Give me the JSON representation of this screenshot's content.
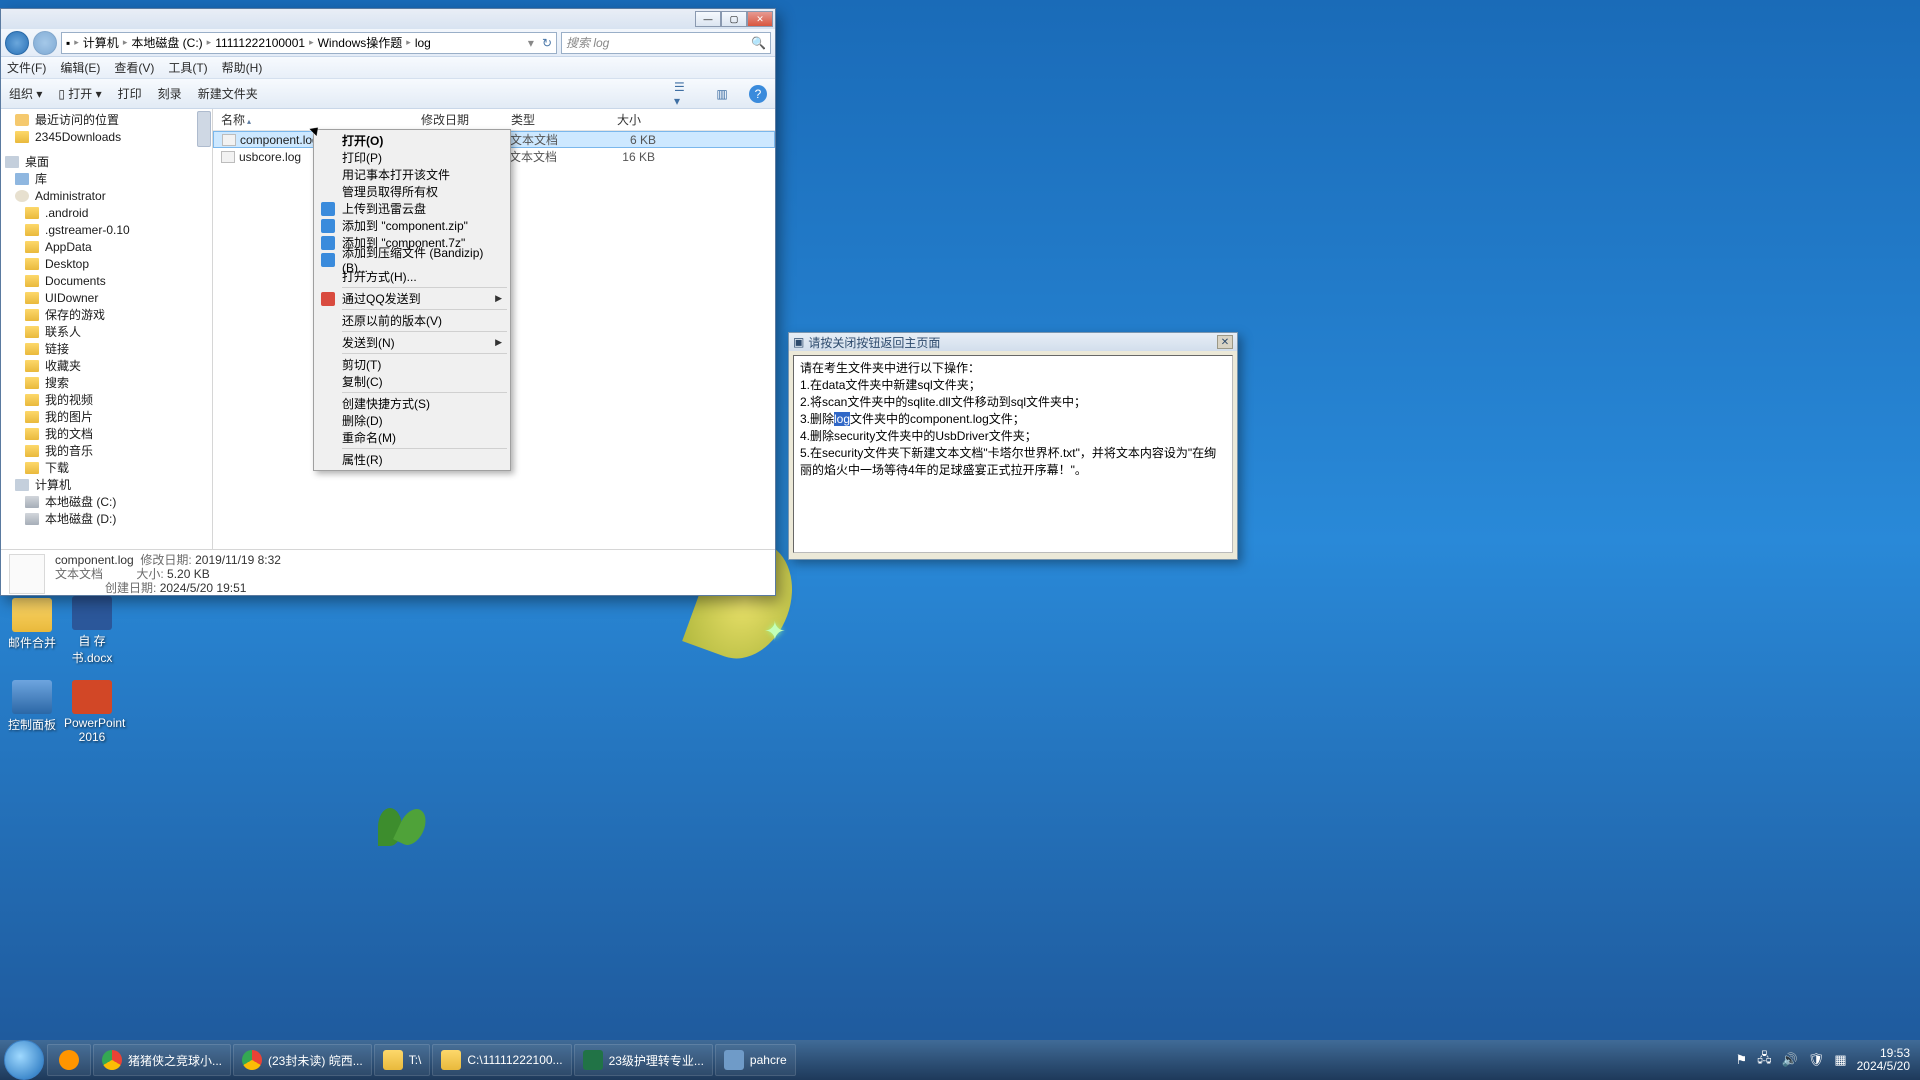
{
  "breadcrumb": [
    "计算机",
    "本地磁盘 (C:)",
    "11111222100001",
    "Windows操作题",
    "log"
  ],
  "search_placeholder": "搜索 log",
  "menus": [
    "文件(F)",
    "编辑(E)",
    "查看(V)",
    "工具(T)",
    "帮助(H)"
  ],
  "toolbar": {
    "organize": "组织 ▾",
    "open": "打开 ▾",
    "print": "打印",
    "burn": "刻录",
    "newfolder": "新建文件夹"
  },
  "columns": {
    "name": "名称",
    "date": "修改日期",
    "type": "类型",
    "size": "大小"
  },
  "files": [
    {
      "name": "component.log",
      "date": "2019/11/19 8:32",
      "type": "文本文档",
      "size": "6 KB",
      "selected": true
    },
    {
      "name": "usbcore.log",
      "date": "",
      "type": "文本文档",
      "size": "16 KB",
      "selected": false
    }
  ],
  "sidebar": {
    "recent": "最近访问的位置",
    "dl": "2345Downloads",
    "desktop": "桌面",
    "libs": "库",
    "admin": "Administrator",
    "items": [
      ".android",
      ".gstreamer-0.10",
      "AppData",
      "Desktop",
      "Documents",
      "UIDowner",
      "保存的游戏",
      "联系人",
      "链接",
      "收藏夹",
      "搜索",
      "我的视频",
      "我的图片",
      "我的文档",
      "我的音乐",
      "下载"
    ],
    "computer": "计算机",
    "driveC": "本地磁盘 (C:)",
    "driveD": "本地磁盘 (D:)"
  },
  "status": {
    "name": "component.log",
    "type": "文本文档",
    "l_date": "修改日期:",
    "date": "2019/11/19 8:32",
    "l_size": "大小:",
    "size": "5.20 KB",
    "l_created": "创建日期:",
    "created": "2024/5/20 19:51"
  },
  "context": [
    {
      "t": "打开(O)",
      "bold": true
    },
    {
      "t": "打印(P)"
    },
    {
      "t": "用记事本打开该文件"
    },
    {
      "t": "管理员取得所有权"
    },
    {
      "t": "上传到迅雷云盘",
      "ico": "cloud"
    },
    {
      "t": "添加到 \"component.zip\"",
      "ico": "zip"
    },
    {
      "t": "添加到 \"component.7z\"",
      "ico": "zip"
    },
    {
      "t": "添加到压缩文件 (Bandizip)(B)...",
      "ico": "zip"
    },
    {
      "t": "打开方式(H)..."
    },
    {
      "sep": true
    },
    {
      "t": "通过QQ发送到",
      "ico": "qq",
      "sub": true
    },
    {
      "sep": true
    },
    {
      "t": "还原以前的版本(V)"
    },
    {
      "sep": true
    },
    {
      "t": "发送到(N)",
      "sub": true
    },
    {
      "sep": true
    },
    {
      "t": "剪切(T)"
    },
    {
      "t": "复制(C)"
    },
    {
      "sep": true
    },
    {
      "t": "创建快捷方式(S)"
    },
    {
      "t": "删除(D)"
    },
    {
      "t": "重命名(M)"
    },
    {
      "sep": true
    },
    {
      "t": "属性(R)"
    }
  ],
  "taskwin": {
    "title": "请按关闭按钮返回主页面",
    "pre": "请在考生文件夹中进行以下操作：\n1.在data文件夹中新建sql文件夹；\n2.将scan文件夹中的sqlite.dll文件移动到sql文件夹中；\n3.删除",
    "hl": "log",
    "post": "文件夹中的component.log文件；\n4.删除security文件夹中的UsbDriver文件夹；\n5.在security文件夹下新建文本文档\"卡塔尔世界杯.txt\"，并将文本内容设为\"在绚丽的焰火中一场等待4年的足球盛宴正式拉开序幕！\"。"
  },
  "dicons": {
    "d1": "邮件合并",
    "d2": "自 存 书.docx",
    "d3": "控制面板",
    "d4": "PowerPoint 2016"
  },
  "taskbar": {
    "t1": "猪猪侠之竞球小...",
    "t2": "(23封未读) 皖西...",
    "t3": "T:\\",
    "t4": "C:\\11111222100...",
    "t5": "23级护理转专业...",
    "t6": "pahcre",
    "time": "19:53",
    "date": "2024/5/20"
  }
}
